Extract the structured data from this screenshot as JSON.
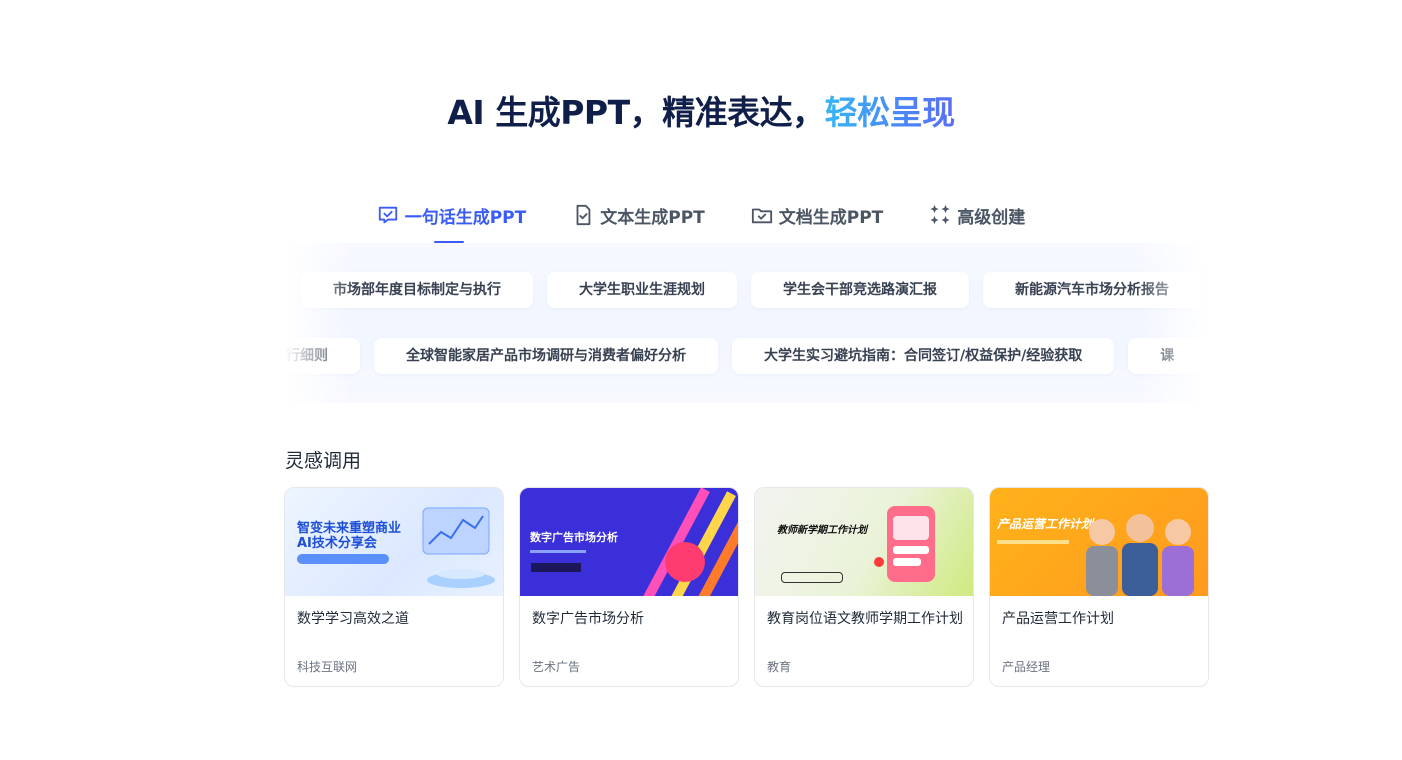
{
  "hero": {
    "title_main": "AI 生成PPT，精准表达，",
    "title_highlight": "轻松呈现"
  },
  "tabs": [
    {
      "label": "一句话生成PPT",
      "icon": "chat-check-icon",
      "active": true
    },
    {
      "label": "文本生成PPT",
      "icon": "document-check-icon",
      "active": false
    },
    {
      "label": "文档生成PPT",
      "icon": "folder-check-icon",
      "active": false
    },
    {
      "label": "高级创建",
      "icon": "sparkle-icon",
      "active": false
    }
  ],
  "prompts": {
    "row1": [
      "市场部年度目标制定与执行",
      "大学生职业生涯规划",
      "学生会干部竞选路演汇报",
      "新能源汽车市场分析报告"
    ],
    "row2": [
      "预算执行细则",
      "全球智能家居产品市场调研与消费者偏好分析",
      "大学生实习避坑指南：合同签订/权益保护/经验获取",
      "课"
    ]
  },
  "inspiration": {
    "title": "灵感调用",
    "cards": [
      {
        "title": "数学学习高效之道",
        "tag": "科技互联网",
        "thumb_text": "智变未来重塑商业\nAI技术分享会"
      },
      {
        "title": "数字广告市场分析",
        "tag": "艺术广告",
        "thumb_text": "数字广告市场分析"
      },
      {
        "title": "教育岗位语文教师学期工作计划",
        "tag": "教育",
        "thumb_text": "教师新学期工作计划"
      },
      {
        "title": "产品运营工作计划",
        "tag": "产品经理",
        "thumb_text": "产品运营工作计划"
      }
    ]
  },
  "colors": {
    "accent": "#3b5bf6",
    "highlight_start": "#38b6f6",
    "title": "#0f1f4a"
  }
}
